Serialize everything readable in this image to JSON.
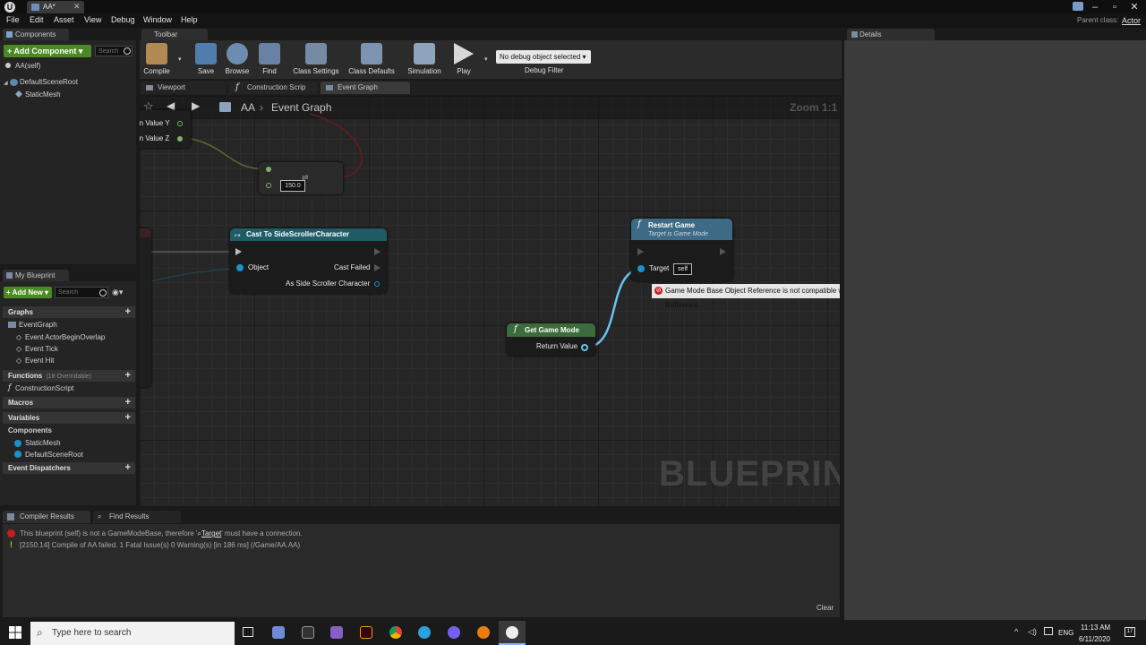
{
  "window": {
    "doc_tab": "AA*",
    "parent_class_label": "Parent class:",
    "parent_class_value": "Actor"
  },
  "menu": [
    "File",
    "Edit",
    "Asset",
    "View",
    "Debug",
    "Window",
    "Help"
  ],
  "components_panel": {
    "tab": "Components",
    "add_button": "+ Add Component ▾",
    "search_placeholder": "Search",
    "self_item": "AA(self)",
    "items": [
      "DefaultSceneRoot",
      "StaticMesh"
    ]
  },
  "toolbar": {
    "tab": "Toolbar",
    "buttons": [
      "Compile",
      "Save",
      "Browse",
      "Find",
      "Class Settings",
      "Class Defaults",
      "Simulation",
      "Play"
    ],
    "debug_select": "No debug object selected ▾",
    "debug_label": "Debug Filter"
  },
  "editor_tabs": [
    "Viewport",
    "Construction Scrip",
    "Event Graph"
  ],
  "breadcrumb": {
    "root": "AA",
    "graph": "Event Graph"
  },
  "zoom": "Zoom 1:1",
  "watermark": "BLUEPRINT",
  "nodes": {
    "partial_pins": [
      "rn Value Y",
      "rn Value Z"
    ],
    "float_value": "150.0",
    "cast": {
      "title": "Cast To SideScrollerCharacter",
      "object": "Object",
      "failed": "Cast Failed",
      "as": "As Side Scroller Character"
    },
    "restart": {
      "title": "Restart Game",
      "subtitle": "Target is Game Mode",
      "target": "Target",
      "self": "self"
    },
    "get_game_mode": {
      "title": "Get Game Mode",
      "return": "Return Value"
    },
    "tooltip": "Game Mode Base Object Reference is not compatible with Game Mode Object Reference."
  },
  "my_blueprint": {
    "tab": "My Blueprint",
    "add_button": "+ Add New ▾",
    "search_placeholder": "Search",
    "graphs_label": "Graphs",
    "event_graph": "EventGraph",
    "events": [
      "Event ActorBeginOverlap",
      "Event Tick",
      "Event Hit"
    ],
    "functions_label": "Functions",
    "functions_note": "(18 Overridable)",
    "construction_script": "ConstructionScript",
    "macros_label": "Macros",
    "variables_label": "Variables",
    "components_label": "Components",
    "components": [
      "StaticMesh",
      "DefaultSceneRoot"
    ],
    "dispatchers_label": "Event Dispatchers"
  },
  "details": {
    "tab": "Details"
  },
  "bottom": {
    "tabs": [
      "Compiler Results",
      "Find Results"
    ],
    "messages": [
      {
        "prefix": "This blueprint (self) is not a GameModeBase, therefore '",
        "target": "Target",
        "suffix": "' must have a connection."
      },
      {
        "text": "[2150.14] Compile of AA failed. 1 Fatal Issue(s) 0 Warning(s) [in 186 ms] (/Game/AA.AA)"
      }
    ],
    "clear": "Clear"
  },
  "taskbar": {
    "search_placeholder": "Type here to search",
    "lang": "ENG",
    "time": "11:13 AM",
    "date": "6/11/2020",
    "notification_count": "17"
  },
  "colors": {
    "cast_header": "#1f5c66",
    "restart_header": "#3d6a85",
    "get_header": "#3c6b3c",
    "wire": "#5fb1e6",
    "accent_green": "#4a8a24"
  }
}
